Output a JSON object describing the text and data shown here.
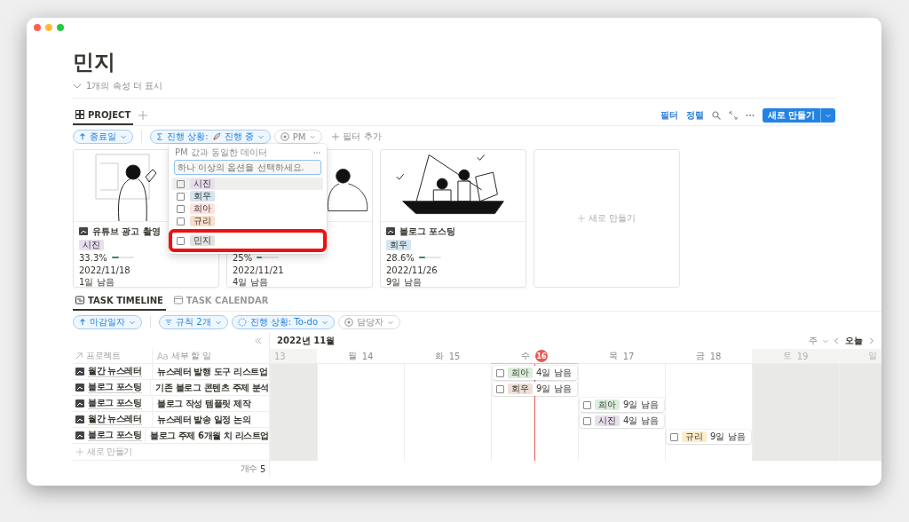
{
  "page": {
    "title": "민지",
    "more_properties": "1개의 속성 더 표시"
  },
  "project_view": {
    "tabs": [
      {
        "label": "PROJECT",
        "selected": true
      }
    ],
    "actions": [
      "필터",
      "정렬"
    ],
    "new_button": "새로 만들기",
    "filters": [
      {
        "kind": "sort",
        "label": "종료일",
        "active": true
      },
      {
        "kind": "formula",
        "label": "진행 상황:",
        "value": "진행 중",
        "active": true
      },
      {
        "kind": "person",
        "label": "PM",
        "active": false
      },
      {
        "kind": "add",
        "label": "필터 추가",
        "active": false
      }
    ],
    "cards": [
      {
        "title": "유튜브 광고 촬영",
        "tag": {
          "label": "시진",
          "color": "#e8deee"
        },
        "progress": "33.3%",
        "level": 0.333,
        "date": "2022/11/18",
        "remaining": "1일 남음"
      },
      {
        "progress": "25%",
        "level": 0.25,
        "date": "2022/11/21",
        "remaining": "4일 남음"
      },
      {
        "title": "블로그 포스팅",
        "tag": {
          "label": "회우",
          "color": "#d3e5ef"
        },
        "progress": "28.6%",
        "level": 0.286,
        "date": "2022/11/26",
        "remaining": "9일 남음"
      }
    ],
    "new_card": "새로 만들기",
    "popup": {
      "header": "PM 값과 동일한 데이터",
      "placeholder": "하나 이상의 옵션을 선택하세요.",
      "options": [
        {
          "label": "시진",
          "color": "#e8deee",
          "checked": false,
          "hovered": true,
          "highlighted": false
        },
        {
          "label": "회우",
          "color": "#d3e5ef",
          "checked": false,
          "hovered": false,
          "highlighted": false
        },
        {
          "label": "희아",
          "color": "#ffe2dd",
          "checked": false,
          "hovered": false,
          "highlighted": false
        },
        {
          "label": "규리",
          "color": "#fadec9",
          "checked": false,
          "hovered": false,
          "highlighted": false
        },
        {
          "label": "민지",
          "color": "#e3e2e0",
          "checked": false,
          "hovered": false,
          "highlighted": true
        }
      ]
    }
  },
  "task_view": {
    "tabs": [
      {
        "label": "TASK TIMELINE",
        "kind": "timeline",
        "selected": true
      },
      {
        "label": "TASK CALENDAR",
        "kind": "calendar",
        "selected": false
      }
    ],
    "filters": [
      {
        "kind": "sort",
        "label": "마감일자",
        "active": true
      },
      {
        "kind": "rules",
        "label": "규칙 2개",
        "active": true
      },
      {
        "kind": "status",
        "label": "진행 상황: To-do",
        "active": true
      },
      {
        "kind": "person",
        "label": "담당자",
        "active": false
      }
    ],
    "columns": [
      {
        "label": "프로젝트",
        "kind": "relation"
      },
      {
        "label": "세부 할 일",
        "kind": "title",
        "icon_text": "Aa"
      }
    ],
    "month": "2022년 11월",
    "scale": "주",
    "today_button": "오늘",
    "rows": [
      {
        "project": "월간 뉴스레터",
        "task": "뉴스레터 발행 도구 리스트업"
      },
      {
        "project": "블로그 포스팅",
        "task": "기존 블로그 콘텐츠 주제 분석"
      },
      {
        "project": "블로그 포스팅",
        "task": "블로그 작성 템플릿 제작"
      },
      {
        "project": "월간 뉴스레터",
        "task": "뉴스레터 발송 일정 논의"
      },
      {
        "project": "블로그 포스팅",
        "task": "블로그 주제 6개월 치 리스트업"
      }
    ],
    "days": [
      {
        "day": "13",
        "weekend": true,
        "today": false
      },
      {
        "weekday": "월",
        "day": "14",
        "weekend": false,
        "today": false
      },
      {
        "weekday": "화",
        "day": "15",
        "weekend": false,
        "today": false
      },
      {
        "weekday": "수",
        "day": "16",
        "weekend": false,
        "today": true,
        "bars": [
          {
            "tag": "희아",
            "color": "#dbeddb",
            "remaining": "4일 남음",
            "checked": false
          },
          {
            "tag": "회우",
            "color": "#eee0da",
            "remaining": "9일 남음",
            "checked": false
          }
        ]
      },
      {
        "weekday": "목",
        "day": "17",
        "weekend": false,
        "today": false,
        "bars": [
          {
            "tag": "희아",
            "color": "#dbeddb",
            "remaining": "9일 남음",
            "checked": false
          },
          {
            "tag": "시진",
            "color": "#e8deee",
            "remaining": "4일 남음",
            "checked": false
          }
        ]
      },
      {
        "weekday": "금",
        "day": "18",
        "weekend": false,
        "today": false,
        "bars": [
          {
            "tag": "규리",
            "color": "#fdecc8",
            "remaining": "9일 남음",
            "checked": false
          }
        ]
      },
      {
        "weekday": "토",
        "day": "19",
        "weekend": true,
        "today": false
      },
      {
        "weekday": "일",
        "weekend": true,
        "today": false
      }
    ],
    "new_row": "새로 만들기",
    "count_label": "개수",
    "count": "5"
  }
}
